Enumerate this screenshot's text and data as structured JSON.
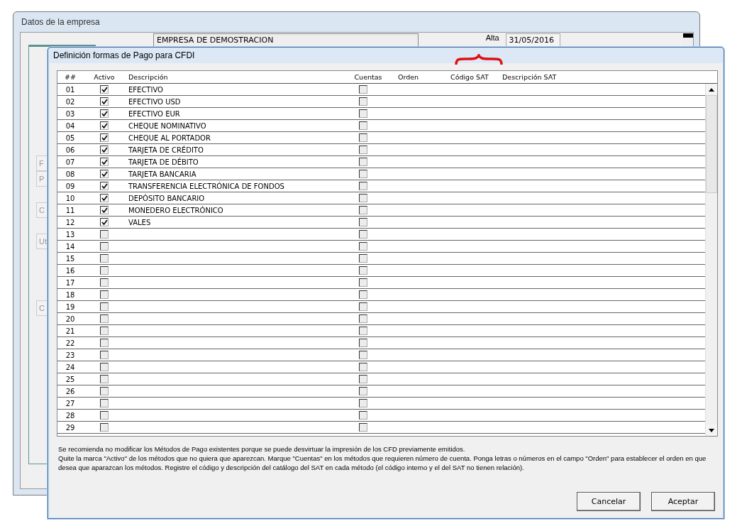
{
  "background_window": {
    "title": "Datos de la empresa",
    "company": "EMPRESA DE DEMOSTRACION",
    "alta_label": "Alta",
    "alta_date": "31/05/2016",
    "side_buttons": [
      "F",
      "P",
      "C",
      "Ut",
      "C"
    ]
  },
  "dialog": {
    "title": "Definición formas de Pago para CFDI",
    "table": {
      "columns": [
        "##",
        "Activo",
        "Descripción",
        "Cuentas",
        "Orden",
        "Código SAT",
        "Descripción SAT"
      ],
      "rows": [
        {
          "number": "01",
          "active": true,
          "description": "EFECTIVO",
          "cuentas": false
        },
        {
          "number": "02",
          "active": true,
          "description": "EFECTIVO USD",
          "cuentas": false
        },
        {
          "number": "03",
          "active": true,
          "description": "EFECTIVO EUR",
          "cuentas": false
        },
        {
          "number": "04",
          "active": true,
          "description": "CHEQUE NOMINATIVO",
          "cuentas": false
        },
        {
          "number": "05",
          "active": true,
          "description": "CHEQUE AL PORTADOR",
          "cuentas": false
        },
        {
          "number": "06",
          "active": true,
          "description": "TARJETA DE CRÉDITO",
          "cuentas": false
        },
        {
          "number": "07",
          "active": true,
          "description": "TARJETA DE DÉBITO",
          "cuentas": false
        },
        {
          "number": "08",
          "active": true,
          "description": "TARJETA BANCARIA",
          "cuentas": false
        },
        {
          "number": "09",
          "active": true,
          "description": "TRANSFERENCIA ELECTRÓNICA DE FONDOS",
          "cuentas": false
        },
        {
          "number": "10",
          "active": true,
          "description": "DEPÓSITO BANCARIO",
          "cuentas": false
        },
        {
          "number": "11",
          "active": true,
          "description": "MONEDERO ELECTRÓNICO",
          "cuentas": false
        },
        {
          "number": "12",
          "active": true,
          "description": "VALES",
          "cuentas": false
        },
        {
          "number": "13",
          "active": false,
          "cuentas": false
        },
        {
          "number": "14",
          "active": false,
          "cuentas": false
        },
        {
          "number": "15",
          "active": false,
          "cuentas": false
        },
        {
          "number": "16",
          "active": false,
          "cuentas": false
        },
        {
          "number": "17",
          "active": false,
          "cuentas": false
        },
        {
          "number": "18",
          "active": false,
          "cuentas": false
        },
        {
          "number": "19",
          "active": false,
          "cuentas": false
        },
        {
          "number": "20",
          "active": false,
          "cuentas": false
        },
        {
          "number": "21",
          "active": false,
          "cuentas": false
        },
        {
          "number": "22",
          "active": false,
          "cuentas": false
        },
        {
          "number": "23",
          "active": false,
          "cuentas": false
        },
        {
          "number": "24",
          "active": false,
          "cuentas": false
        },
        {
          "number": "25",
          "active": false,
          "cuentas": false
        },
        {
          "number": "26",
          "active": false,
          "cuentas": false
        },
        {
          "number": "27",
          "active": false,
          "cuentas": false
        },
        {
          "number": "28",
          "active": false,
          "cuentas": false
        },
        {
          "number": "29",
          "active": false,
          "cuentas": false
        }
      ]
    },
    "notes": [
      "Se recomienda no modificar los Métodos de Pago existentes porque se puede desvirtuar la impresión de los CFD previamente emitidos.",
      "Quite la marca \"Activo\" de los métodos que no quiera que aparezcan. Marque \"Cuentas\" en los métodos que requieren número de cuenta. Ponga letras o números en el campo \"Orden\" para establecer el orden en que desea que aparazcan los métodos. Registre el código y descripción del catálogo del SAT en cada método (el código interno y el del SAT no tienen relación)."
    ],
    "buttons": [
      "Cancelar",
      "Aceptar"
    ]
  }
}
